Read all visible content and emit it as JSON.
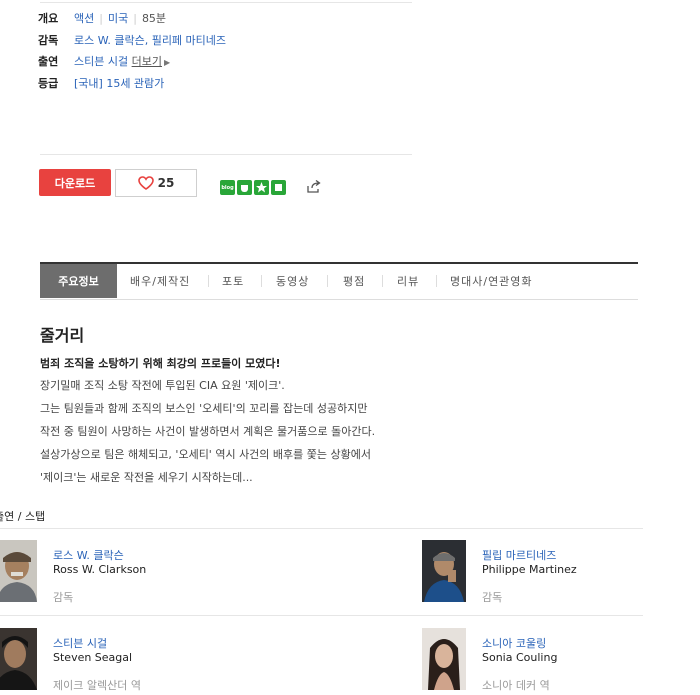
{
  "info": {
    "overview_label": "개요",
    "genre": "액션",
    "country": "미국",
    "runtime": "85분",
    "director_label": "감독",
    "directors": "로스 W. 클락슨, 필리페 마티네즈",
    "cast_label": "출연",
    "cast": "스티븐 시걸",
    "more_link": "더보기",
    "rating_label": "등급",
    "rating": "[국내] 15세 관람가"
  },
  "actions": {
    "download_label": "다운로드",
    "like_count": "25",
    "blog_label": "blog",
    "heart_color": "#e8423f",
    "download_color": "#e8423f"
  },
  "tabs": [
    {
      "label": "주요정보"
    },
    {
      "label": "배우/제작진"
    },
    {
      "label": "포토"
    },
    {
      "label": "동영상"
    },
    {
      "label": "평점"
    },
    {
      "label": "리뷰"
    },
    {
      "label": "명대사/연관영화"
    }
  ],
  "synopsis": {
    "heading": "줄거리",
    "lead": "범죄 조직을 소탕하기 위해 최강의 프로들이 모였다!",
    "lines": [
      "장기밀매 조직 소탕 작전에 투입된 CIA 요원 '제이크'.",
      " 그는 팀원들과 함께 조직의 보스인 '오세티'의 꼬리를 잡는데 성공하지만",
      " 작전 중 팀원이 사망하는 사건이 발생하면서 계획은 물거품으로 돌아간다.",
      " 설상가상으로 팀은 해체되고, '오세티' 역시 사건의 배후를 쫓는 상황에서",
      " '제이크'는 새로운 작전을 세우기 시작하는데..."
    ]
  },
  "cast_section": {
    "heading": "출연 / 스탭",
    "people": [
      {
        "kname": "로스 W. 클락슨",
        "ename": "Ross W. Clarkson",
        "role": "감독"
      },
      {
        "kname": "필립 마르티네즈",
        "ename": "Philippe Martinez",
        "role": "감독"
      },
      {
        "kname": "스티븐 시걸",
        "ename": "Steven Seagal",
        "role": "제이크 알렉산더 역"
      },
      {
        "kname": "소니아 코울링",
        "ename": "Sonia Couling",
        "role": "소니아 데커 역"
      }
    ]
  }
}
